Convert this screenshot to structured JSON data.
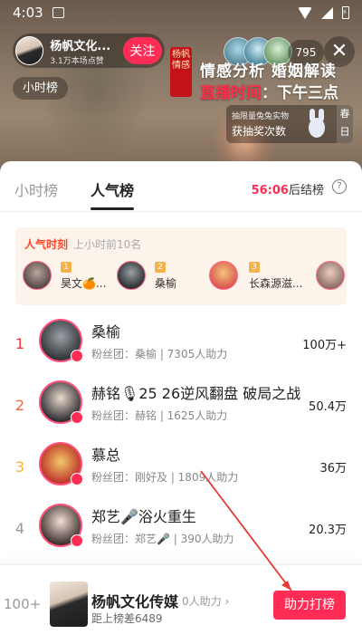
{
  "status_bar": {
    "time": "4:03"
  },
  "live": {
    "host_name": "杨帆文化...",
    "host_likes": "3.1万本场点赞",
    "follow_label": "关注",
    "hour_chip": "小时榜",
    "viewer_count": "795",
    "close_icon": "✕",
    "seal_text": "杨帆情感",
    "banner_title": "情感分析 婚姻解读",
    "banner_time_label": "直播时间",
    "banner_time_sep": "：",
    "banner_time_value": "下午三点",
    "lottery_line1": "抽限量兔兔实物",
    "lottery_line2": "获抽奖次数",
    "lottery_tag": "春日"
  },
  "sheet": {
    "tabs": [
      {
        "label": "小时榜",
        "active": false
      },
      {
        "label": "人气榜",
        "active": true
      }
    ],
    "countdown_time": "56:06",
    "countdown_suffix": "后结榜",
    "help_icon": "?"
  },
  "moment": {
    "title": "人气时刻",
    "subtitle": "上小时前10名",
    "entries": [
      {
        "rank": "1",
        "name": "昊文🍊..."
      },
      {
        "rank": "2",
        "name": "桑榆"
      },
      {
        "rank": "3",
        "name": "长森源滋..."
      }
    ]
  },
  "ranking": [
    {
      "rank": "1",
      "name": "桑榆",
      "sub": "粉丝团：桑榆 | 7305人助力",
      "score": "100万+",
      "rank_color": "#f5343e"
    },
    {
      "rank": "2",
      "name": "赫铭🎙25 26逆风翻盘 破局之战",
      "sub": "粉丝团：赫铭 | 1625人助力",
      "score": "50.4万",
      "rank_color": "#f5643e"
    },
    {
      "rank": "3",
      "name": "慕总",
      "sub": "粉丝团：刚好及 | 1809人助力",
      "score": "36万",
      "rank_color": "#f5b33e"
    },
    {
      "rank": "4",
      "name": "郑艺🎤浴火重生",
      "sub": "粉丝团：郑艺🎤 | 390人助力",
      "score": "20.3万",
      "rank_color": "#999999"
    }
  ],
  "me": {
    "rank": "100+",
    "name": "杨帆文化传媒",
    "help": "0人助力 ›",
    "gap": "距上榜差6489",
    "boost_label": "助力打榜"
  }
}
